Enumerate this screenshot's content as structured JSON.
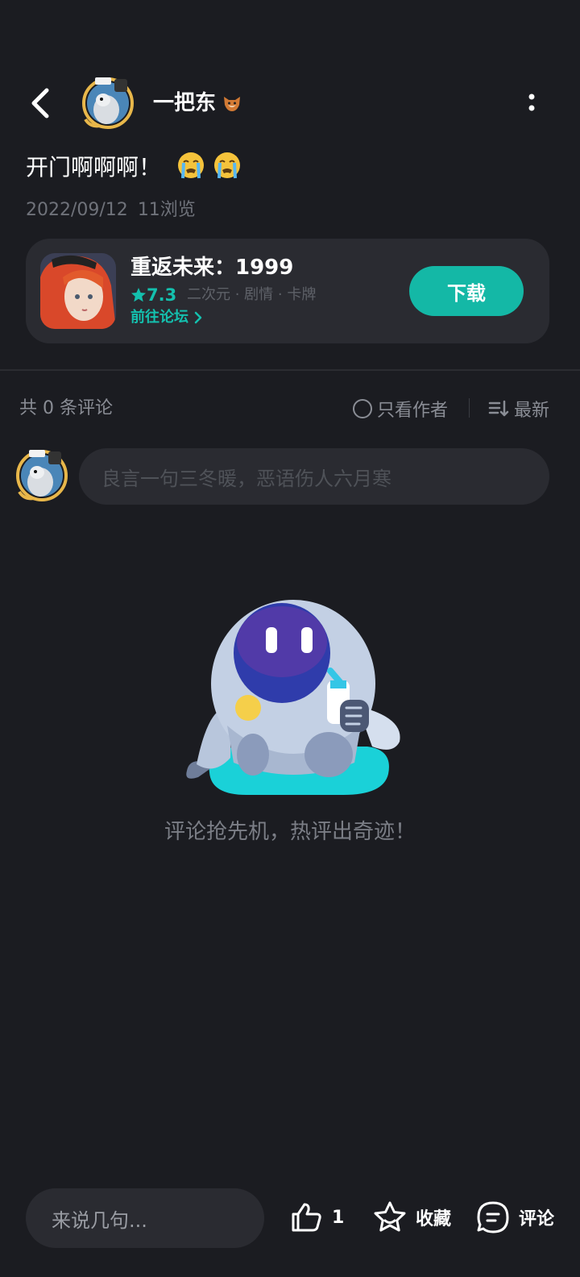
{
  "header": {
    "author_name": "一把东",
    "author_badge_icon": "fox-emoji-icon"
  },
  "post": {
    "title": "开门啊啊啊！",
    "title_emojis": [
      "crying-face-emoji",
      "crying-face-emoji"
    ],
    "date": "2022/09/12",
    "views": "11浏览"
  },
  "game": {
    "name": "重返未来：1999",
    "rating": "7.3",
    "tags": "二次元 · 剧情 · 卡牌",
    "forum_link": "前往论坛",
    "download_label": "下载",
    "accent_color": "#14b8a6"
  },
  "comments": {
    "count_label": "共 0 条评论",
    "author_only_label": "只看作者",
    "sort_label": "最新",
    "input_placeholder": "良言一句三冬暖，恶语伤人六月寒",
    "empty_text": "评论抢先机，热评出奇迹！"
  },
  "bottom_bar": {
    "input_placeholder": "来说几句...",
    "like_count": "1",
    "favorite_label": "收藏",
    "comment_label": "评论"
  }
}
